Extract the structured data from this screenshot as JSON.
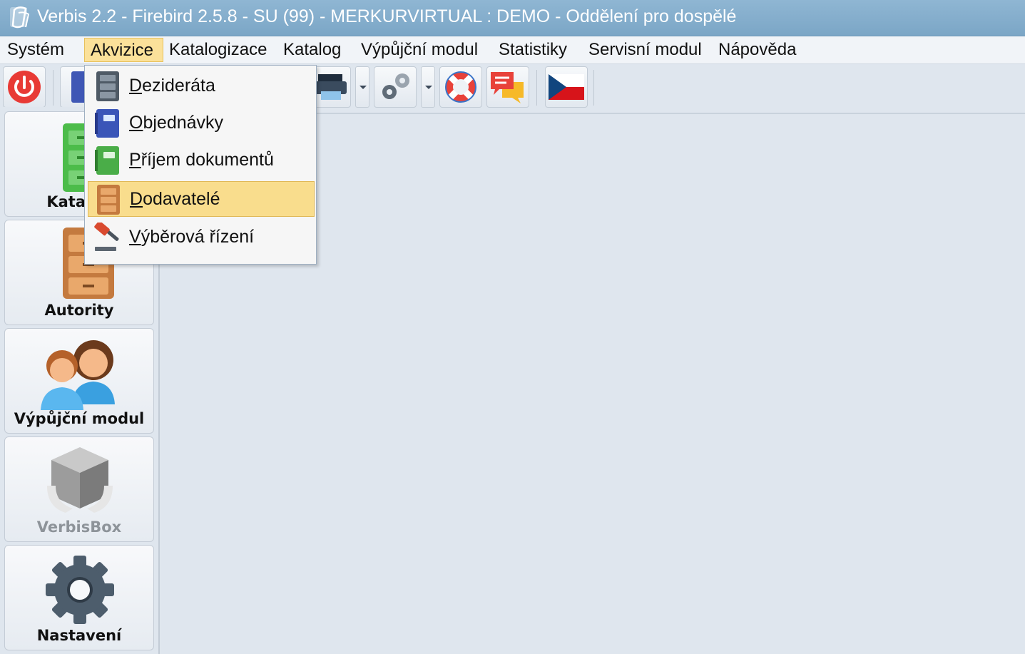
{
  "window": {
    "title": "Verbis 2.2 - Firebird 2.5.8 - SU (99) - MERKURVIRTUAL : DEMO - Oddělení pro dospělé"
  },
  "menubar": {
    "items": [
      {
        "label": "Systém"
      },
      {
        "label": "Akvizice",
        "active": true
      },
      {
        "label": "Katalogizace"
      },
      {
        "label": "Katalog"
      },
      {
        "label": "Výpůjční modul"
      },
      {
        "label": "Statistiky"
      },
      {
        "label": "Servisní modul"
      },
      {
        "label": "Nápověda"
      }
    ]
  },
  "toolbar": {
    "buttons": [
      {
        "icon": "power-icon"
      },
      {
        "icon": "cabinet-icon"
      },
      {
        "icon": "printer-icon"
      },
      {
        "icon": "gears-icon"
      },
      {
        "icon": "lifebuoy-icon"
      },
      {
        "icon": "chat-icon"
      },
      {
        "icon": "czech-flag-icon"
      }
    ]
  },
  "akvizice_menu": {
    "items": [
      {
        "label": "Dezideráta",
        "icon": "gray-cabinet-icon"
      },
      {
        "label": "Objednávky",
        "icon": "blue-notebook-icon"
      },
      {
        "label": "Příjem dokumentů",
        "icon": "green-notebook-icon"
      },
      {
        "label": "Dodavatelé",
        "icon": "brown-cabinet-icon",
        "highlighted": true
      },
      {
        "label": "Výběrová řízení",
        "icon": "gavel-icon"
      }
    ]
  },
  "sidebar": {
    "items": [
      {
        "label": "Katalog",
        "icon": "green-cabinet-icon"
      },
      {
        "label": "Autority",
        "icon": "brown-cabinet-icon"
      },
      {
        "label": "Výpůjční modul",
        "icon": "people-icon"
      },
      {
        "label": "VerbisBox",
        "icon": "box-icon",
        "disabled": true
      },
      {
        "label": "Nastavení",
        "icon": "gear-icon"
      }
    ]
  },
  "colors": {
    "titlebar": "#7ba6c6",
    "menu_highlight": "#fbe19a",
    "background": "#dfe6ee"
  }
}
